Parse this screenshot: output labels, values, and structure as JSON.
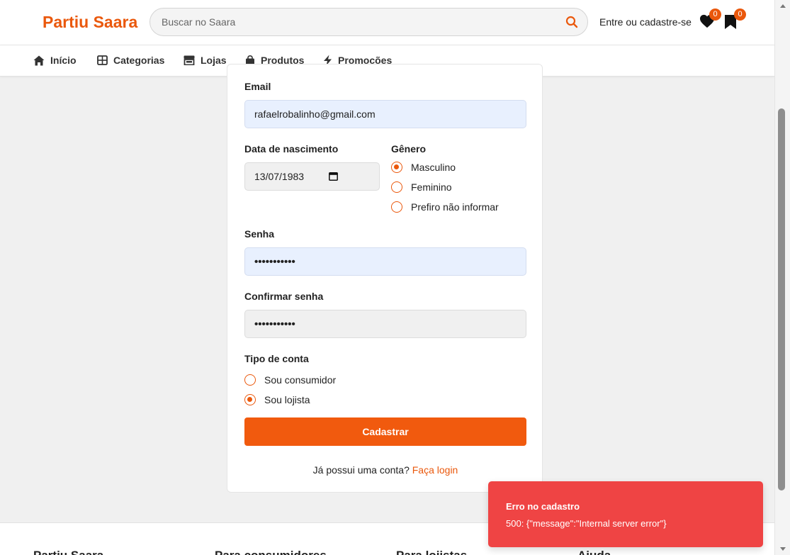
{
  "header": {
    "logo": "Partiu Saara",
    "search_placeholder": "Buscar no Saara",
    "login_link": "Entre ou cadastre-se",
    "favorites_count": "0",
    "saved_count": "0"
  },
  "nav": {
    "items": [
      {
        "label": "Início",
        "icon": "home-icon"
      },
      {
        "label": "Categorias",
        "icon": "grid-icon"
      },
      {
        "label": "Lojas",
        "icon": "store-icon"
      },
      {
        "label": "Produtos",
        "icon": "bag-icon"
      },
      {
        "label": "Promoções",
        "icon": "bolt-icon"
      }
    ]
  },
  "form": {
    "email_label": "Email",
    "email_value": "rafaelrobalinho@gmail.com",
    "birth_label": "Data de nascimento",
    "birth_value": "13/07/1983",
    "gender_label": "Gênero",
    "gender_options": [
      "Masculino",
      "Feminino",
      "Prefiro não informar"
    ],
    "gender_selected": "Masculino",
    "password_label": "Senha",
    "password_value": "•••••••••••",
    "confirm_label": "Confirmar senha",
    "confirm_value": "•••••••••••",
    "account_type_label": "Tipo de conta",
    "account_options": [
      "Sou consumidor",
      "Sou lojista"
    ],
    "account_selected": "Sou lojista",
    "submit_label": "Cadastrar",
    "login_prompt": "Já possui uma conta?",
    "login_link": "Faça login"
  },
  "footer": {
    "columns": [
      "Partiu Saara",
      "Para consumidores",
      "Para lojistas",
      "Ajuda"
    ]
  },
  "toast": {
    "title": "Erro no cadastro",
    "message": "500: {\"message\":\"Internal server error\"}"
  },
  "colors": {
    "brand": "#ea580c",
    "error": "#ef4444",
    "autofill": "#e8f0fe"
  }
}
